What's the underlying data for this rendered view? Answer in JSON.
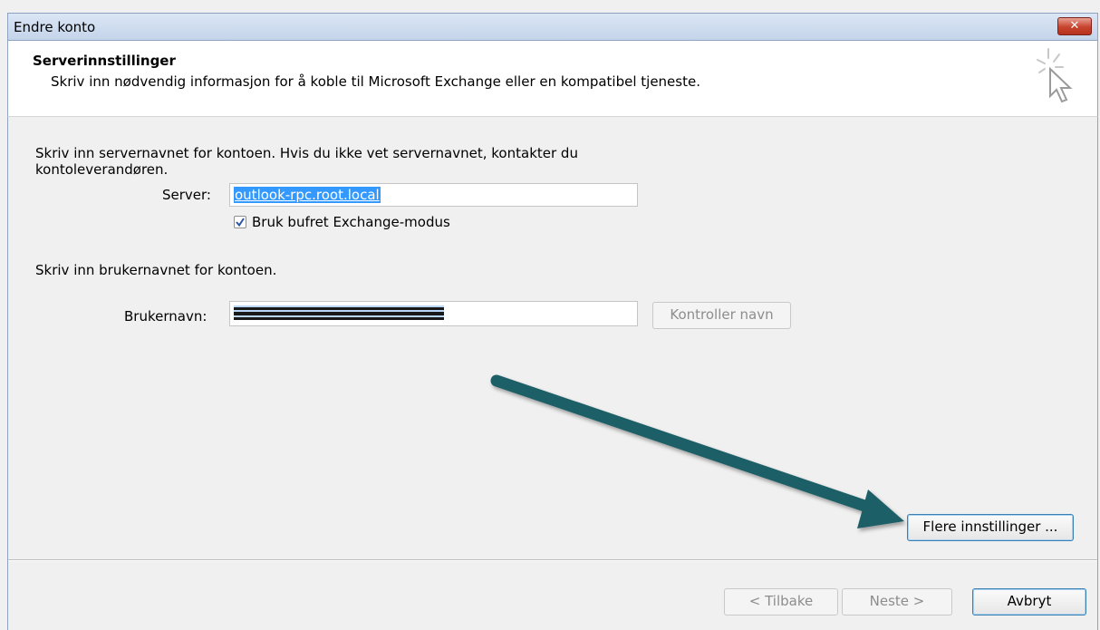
{
  "window": {
    "title": "Endre konto"
  },
  "header": {
    "title": "Serverinnstillinger",
    "subtitle": "Skriv inn nødvendig informasjon for å koble til Microsoft Exchange eller en kompatibel tjeneste."
  },
  "server_section": {
    "instruction_line1": "Skriv inn servernavnet for kontoen. Hvis du ikke vet servernavnet, kontakter du",
    "instruction_line2": "kontoleverandøren.",
    "server_label": "Server:",
    "server_value": "outlook-rpc.root.local",
    "cached_mode_label": "Bruk bufret Exchange-modus",
    "cached_mode_checked": true
  },
  "user_section": {
    "instruction": "Skriv inn brukernavnet for kontoen.",
    "username_label": "Brukernavn:",
    "check_name_button": "Kontroller navn"
  },
  "buttons": {
    "more_settings": "Flere innstillinger ...",
    "back": "< Tilbake",
    "next": "Neste >",
    "cancel": "Avbryt"
  },
  "colors": {
    "arrow": "#1f5f66",
    "selection": "#3399ff",
    "close_button": "#c7432d"
  },
  "icons": {
    "close": "close-icon",
    "header": "cursor-click-icon",
    "checkbox": "checkmark-icon",
    "annotation": "arrow-annotation"
  }
}
